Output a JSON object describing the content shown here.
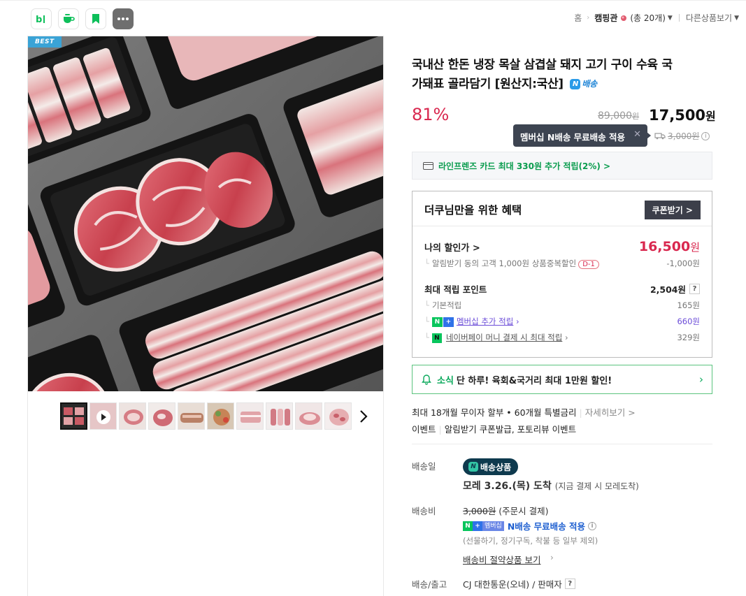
{
  "topbar": {
    "apps": [
      {
        "name": "blog",
        "label": "b|"
      },
      {
        "name": "cafe",
        "label": "cafe"
      },
      {
        "name": "bookmark",
        "label": "bookmark"
      },
      {
        "name": "more",
        "label": "···"
      }
    ],
    "breadcrumb": {
      "home": "홈",
      "category": "캠핑관",
      "count": "(총 20개)",
      "other": "다른상품보기"
    }
  },
  "gallery": {
    "badge": "BEST",
    "thumb_count": 10
  },
  "product": {
    "title": "국내산 한돈 냉장 목살 삼겹살 돼지 고기 구이 수육 국가돼표 골라담기 [원산지:국산]",
    "title_line1": "국내산 한돈 냉장 목살 삼겹살 돼지 고기 구이 수육 국",
    "title_line2": "가돼표 골라담기 [원산지:국산]",
    "n_badge_icon": "N",
    "n_badge_text": "배송",
    "discount_rate": "81%",
    "original_price": "89,000",
    "original_price_unit": "원",
    "sale_price": "17,500",
    "sale_price_unit": "원",
    "tooltip": "멤버십 N배송 무료배송 적용",
    "shipping_fee_strike": "3,000원",
    "card_benefit": "라인프렌즈 카드 최대 330원 추가 적립(2%) >"
  },
  "benefit": {
    "title": "더쿠님만을 위한 혜택",
    "coupon_button": "쿠폰받기 >",
    "my_price_label": "나의 할인가 >",
    "my_price": "16,500",
    "my_price_unit": "원",
    "coupon_desc": "알림받기 동의 고객 1,000원 상품중복할인",
    "dday": "D-1",
    "coupon_amount": "-1,000원",
    "point_label": "최대 적립 포인트",
    "point_value": "2,504원",
    "point_help": "?",
    "basic_label": "기본적립",
    "basic_value": "165원",
    "member_label": "멤버십 추가 적립",
    "member_value": "660원",
    "npay_label": "네이버페이 머니 결제 시 최대 적립",
    "npay_value": "329원"
  },
  "news": {
    "tag": "소식",
    "text": "단 하루! 육회&국거리 최대 1만원 할인!"
  },
  "install": {
    "text": "최대 18개월 무이자 할부 • 60개월 특별금리",
    "link": "자세히보기 >"
  },
  "event": {
    "label": "이벤트",
    "text": "알림받기 쿠폰발급, 포토리뷰 이벤트"
  },
  "delivery": {
    "date_label": "배송일",
    "badge": "배송상품",
    "arrive_main": "모레 3.26.(목) 도착",
    "arrive_note": "(지금 결제 시 모레도착)",
    "fee_label": "배송비",
    "fee_strike": "3,000원",
    "fee_note": "(주문시 결제)",
    "membership_tag": "멤버십",
    "membership_text": "N배송 무료배송 적용",
    "exclusion": "(선물하기, 정기구독, 착불 등 일부 제외)",
    "save_link": "배송비 절약상품 보기",
    "ship_label": "배송/출고",
    "ship_value": "CJ 대한통운(오네) / 판매자"
  },
  "colors": {
    "discount": "#d9284f",
    "naver_green": "#08c55c",
    "tooltip_bg": "#3d4451",
    "membership_purple": "#6b4cd8"
  }
}
